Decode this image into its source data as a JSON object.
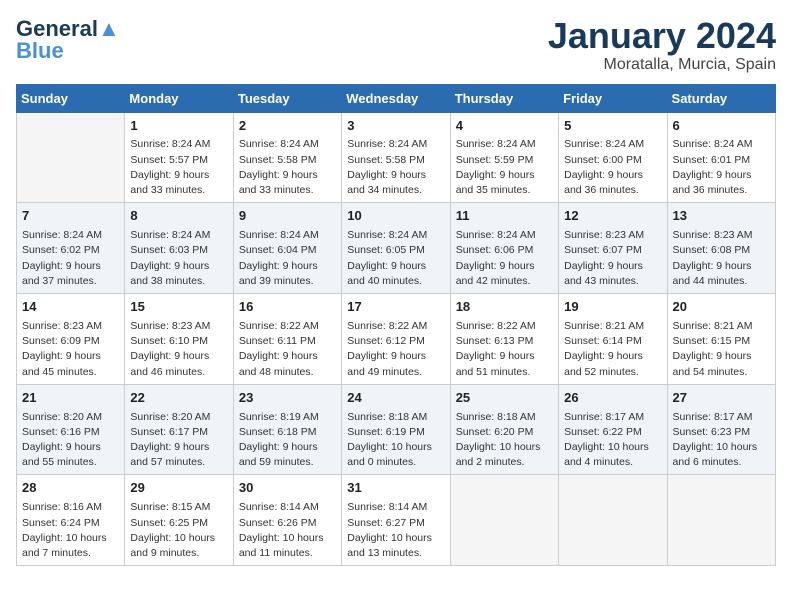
{
  "header": {
    "logo_line1": "General",
    "logo_line2": "Blue",
    "title": "January 2024",
    "subtitle": "Moratalla, Murcia, Spain"
  },
  "days_of_week": [
    "Sunday",
    "Monday",
    "Tuesday",
    "Wednesday",
    "Thursday",
    "Friday",
    "Saturday"
  ],
  "weeks": [
    [
      {
        "day": "",
        "sunrise": "",
        "sunset": "",
        "daylight": ""
      },
      {
        "day": "1",
        "sunrise": "Sunrise: 8:24 AM",
        "sunset": "Sunset: 5:57 PM",
        "daylight": "Daylight: 9 hours and 33 minutes."
      },
      {
        "day": "2",
        "sunrise": "Sunrise: 8:24 AM",
        "sunset": "Sunset: 5:58 PM",
        "daylight": "Daylight: 9 hours and 33 minutes."
      },
      {
        "day": "3",
        "sunrise": "Sunrise: 8:24 AM",
        "sunset": "Sunset: 5:58 PM",
        "daylight": "Daylight: 9 hours and 34 minutes."
      },
      {
        "day": "4",
        "sunrise": "Sunrise: 8:24 AM",
        "sunset": "Sunset: 5:59 PM",
        "daylight": "Daylight: 9 hours and 35 minutes."
      },
      {
        "day": "5",
        "sunrise": "Sunrise: 8:24 AM",
        "sunset": "Sunset: 6:00 PM",
        "daylight": "Daylight: 9 hours and 36 minutes."
      },
      {
        "day": "6",
        "sunrise": "Sunrise: 8:24 AM",
        "sunset": "Sunset: 6:01 PM",
        "daylight": "Daylight: 9 hours and 36 minutes."
      }
    ],
    [
      {
        "day": "7",
        "sunrise": "Sunrise: 8:24 AM",
        "sunset": "Sunset: 6:02 PM",
        "daylight": "Daylight: 9 hours and 37 minutes."
      },
      {
        "day": "8",
        "sunrise": "Sunrise: 8:24 AM",
        "sunset": "Sunset: 6:03 PM",
        "daylight": "Daylight: 9 hours and 38 minutes."
      },
      {
        "day": "9",
        "sunrise": "Sunrise: 8:24 AM",
        "sunset": "Sunset: 6:04 PM",
        "daylight": "Daylight: 9 hours and 39 minutes."
      },
      {
        "day": "10",
        "sunrise": "Sunrise: 8:24 AM",
        "sunset": "Sunset: 6:05 PM",
        "daylight": "Daylight: 9 hours and 40 minutes."
      },
      {
        "day": "11",
        "sunrise": "Sunrise: 8:24 AM",
        "sunset": "Sunset: 6:06 PM",
        "daylight": "Daylight: 9 hours and 42 minutes."
      },
      {
        "day": "12",
        "sunrise": "Sunrise: 8:23 AM",
        "sunset": "Sunset: 6:07 PM",
        "daylight": "Daylight: 9 hours and 43 minutes."
      },
      {
        "day": "13",
        "sunrise": "Sunrise: 8:23 AM",
        "sunset": "Sunset: 6:08 PM",
        "daylight": "Daylight: 9 hours and 44 minutes."
      }
    ],
    [
      {
        "day": "14",
        "sunrise": "Sunrise: 8:23 AM",
        "sunset": "Sunset: 6:09 PM",
        "daylight": "Daylight: 9 hours and 45 minutes."
      },
      {
        "day": "15",
        "sunrise": "Sunrise: 8:23 AM",
        "sunset": "Sunset: 6:10 PM",
        "daylight": "Daylight: 9 hours and 46 minutes."
      },
      {
        "day": "16",
        "sunrise": "Sunrise: 8:22 AM",
        "sunset": "Sunset: 6:11 PM",
        "daylight": "Daylight: 9 hours and 48 minutes."
      },
      {
        "day": "17",
        "sunrise": "Sunrise: 8:22 AM",
        "sunset": "Sunset: 6:12 PM",
        "daylight": "Daylight: 9 hours and 49 minutes."
      },
      {
        "day": "18",
        "sunrise": "Sunrise: 8:22 AM",
        "sunset": "Sunset: 6:13 PM",
        "daylight": "Daylight: 9 hours and 51 minutes."
      },
      {
        "day": "19",
        "sunrise": "Sunrise: 8:21 AM",
        "sunset": "Sunset: 6:14 PM",
        "daylight": "Daylight: 9 hours and 52 minutes."
      },
      {
        "day": "20",
        "sunrise": "Sunrise: 8:21 AM",
        "sunset": "Sunset: 6:15 PM",
        "daylight": "Daylight: 9 hours and 54 minutes."
      }
    ],
    [
      {
        "day": "21",
        "sunrise": "Sunrise: 8:20 AM",
        "sunset": "Sunset: 6:16 PM",
        "daylight": "Daylight: 9 hours and 55 minutes."
      },
      {
        "day": "22",
        "sunrise": "Sunrise: 8:20 AM",
        "sunset": "Sunset: 6:17 PM",
        "daylight": "Daylight: 9 hours and 57 minutes."
      },
      {
        "day": "23",
        "sunrise": "Sunrise: 8:19 AM",
        "sunset": "Sunset: 6:18 PM",
        "daylight": "Daylight: 9 hours and 59 minutes."
      },
      {
        "day": "24",
        "sunrise": "Sunrise: 8:18 AM",
        "sunset": "Sunset: 6:19 PM",
        "daylight": "Daylight: 10 hours and 0 minutes."
      },
      {
        "day": "25",
        "sunrise": "Sunrise: 8:18 AM",
        "sunset": "Sunset: 6:20 PM",
        "daylight": "Daylight: 10 hours and 2 minutes."
      },
      {
        "day": "26",
        "sunrise": "Sunrise: 8:17 AM",
        "sunset": "Sunset: 6:22 PM",
        "daylight": "Daylight: 10 hours and 4 minutes."
      },
      {
        "day": "27",
        "sunrise": "Sunrise: 8:17 AM",
        "sunset": "Sunset: 6:23 PM",
        "daylight": "Daylight: 10 hours and 6 minutes."
      }
    ],
    [
      {
        "day": "28",
        "sunrise": "Sunrise: 8:16 AM",
        "sunset": "Sunset: 6:24 PM",
        "daylight": "Daylight: 10 hours and 7 minutes."
      },
      {
        "day": "29",
        "sunrise": "Sunrise: 8:15 AM",
        "sunset": "Sunset: 6:25 PM",
        "daylight": "Daylight: 10 hours and 9 minutes."
      },
      {
        "day": "30",
        "sunrise": "Sunrise: 8:14 AM",
        "sunset": "Sunset: 6:26 PM",
        "daylight": "Daylight: 10 hours and 11 minutes."
      },
      {
        "day": "31",
        "sunrise": "Sunrise: 8:14 AM",
        "sunset": "Sunset: 6:27 PM",
        "daylight": "Daylight: 10 hours and 13 minutes."
      },
      {
        "day": "",
        "sunrise": "",
        "sunset": "",
        "daylight": ""
      },
      {
        "day": "",
        "sunrise": "",
        "sunset": "",
        "daylight": ""
      },
      {
        "day": "",
        "sunrise": "",
        "sunset": "",
        "daylight": ""
      }
    ]
  ]
}
